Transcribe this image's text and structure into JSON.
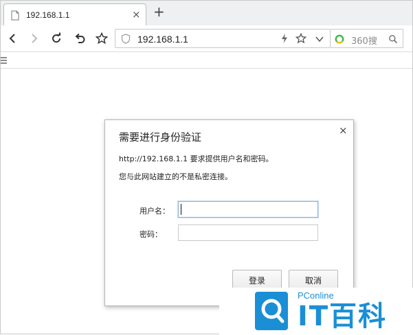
{
  "tab": {
    "title": "192.168.1.1",
    "close": "×"
  },
  "new_tab": "+",
  "address_bar": {
    "url": "192.168.1.1"
  },
  "search_box": {
    "text": "360搜"
  },
  "dialog": {
    "title": "需要进行身份验证",
    "close": "×",
    "message_line1": "http://192.168.1.1 要求提供用户名和密码。",
    "message_line2": "您与此网站建立的不是私密连接。",
    "username_label": "用户名：",
    "username_value": "",
    "password_label": "密码：",
    "password_value": "",
    "login_button": "登录",
    "cancel_button": "取消"
  },
  "watermark": {
    "line1": "PConline",
    "brand": "IT百科"
  },
  "colors": {
    "accent_blue": "#1a8fd6",
    "search_logo_green": "#3db54a",
    "search_logo_yellow": "#f4c21b"
  },
  "icons": [
    "page-icon",
    "back-icon",
    "forward-icon",
    "reload-icon",
    "undo-icon",
    "star-icon",
    "shield-icon",
    "bolt-icon",
    "chevron-down-icon",
    "search-icon",
    "bookmark-list-icon"
  ]
}
